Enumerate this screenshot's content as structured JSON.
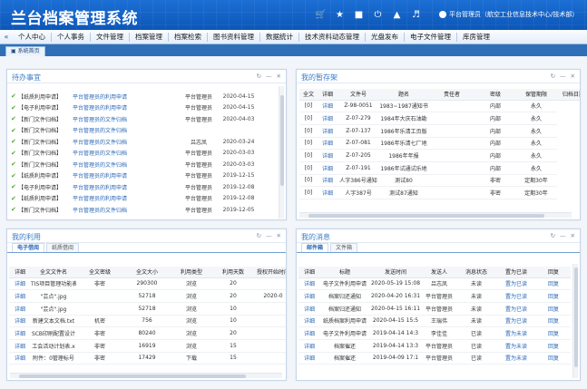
{
  "app": {
    "title": "兰台档案管理系统",
    "user": "平台管理员（航空工业信息技术中心/技术部）"
  },
  "header_icons": [
    "cart-icon",
    "star-icon",
    "lock-icon",
    "power-icon",
    "shirt-icon",
    "volume-icon"
  ],
  "nav": {
    "items": [
      "个人中心",
      "个人事务",
      "文件管理",
      "档案管理",
      "档案检索",
      "图书资料管理",
      "数据统计",
      "技术资料动态管理",
      "光盘发布",
      "电子文件管理",
      "库房管理"
    ]
  },
  "tabs": {
    "home": "系统首页"
  },
  "todo": {
    "title": "待办事宜",
    "rows": [
      {
        "tag": "【纸质利用申请】",
        "title": "平台管理员的利用申请",
        "who": "平台管理员",
        "date": "2020-04-15"
      },
      {
        "tag": "【电子利用申请】",
        "title": "平台管理员的利用申请",
        "who": "平台管理员",
        "date": "2020-04-15"
      },
      {
        "tag": "【新门文件归档】",
        "title": "平台管理员的文件归档",
        "who": "平台管理员",
        "date": "2020-04-03"
      },
      {
        "tag": "【新门文件归档】",
        "title": "平台管理员的文件归档",
        "who": "",
        "date": ""
      },
      {
        "tag": "【新门文件归档】",
        "title": "平台管理员的文件归档",
        "who": "吕志凤",
        "date": "2020-03-24"
      },
      {
        "tag": "【新门文件归档】",
        "title": "平台管理员的文件归档",
        "who": "平台管理员",
        "date": "2020-03-03"
      },
      {
        "tag": "【新门文件归档】",
        "title": "平台管理员的文件归档",
        "who": "平台管理员",
        "date": "2020-03-03"
      },
      {
        "tag": "【纸质利用申请】",
        "title": "平台管理员的利用申请",
        "who": "平台管理员",
        "date": "2019-12-15"
      },
      {
        "tag": "【电子利用申请】",
        "title": "平台管理员的利用申请",
        "who": "平台管理员",
        "date": "2019-12-08"
      },
      {
        "tag": "【纸质利用申请】",
        "title": "平台管理员的利用申请",
        "who": "平台管理员",
        "date": "2019-12-08"
      },
      {
        "tag": "【新门文件归档】",
        "title": "平台管理员的文件归档",
        "who": "平台管理员",
        "date": "2019-12-05"
      }
    ]
  },
  "archive": {
    "title": "我的暂存架",
    "columns": [
      "全文",
      "详细",
      "文件号",
      "题名",
      "责任者",
      "密级",
      "保管期限",
      "归档日期"
    ],
    "rows": [
      {
        "full": "[0]",
        "detail": "详细",
        "no": "Z-98-0051",
        "name": "1983~1987通知书",
        "owner": "",
        "secret": "内部",
        "term": "永久"
      },
      {
        "full": "[0]",
        "detail": "详细",
        "no": "Z-07-279",
        "name": "1984年大庆石油勘",
        "owner": "",
        "secret": "内部",
        "term": "永久"
      },
      {
        "full": "[0]",
        "detail": "详细",
        "no": "Z-07-137",
        "name": "1986年乐清工页版",
        "owner": "",
        "secret": "内部",
        "term": "永久"
      },
      {
        "full": "[0]",
        "detail": "详细",
        "no": "Z-07-081",
        "name": "1986年乐清七厂地",
        "owner": "",
        "secret": "内部",
        "term": "永久"
      },
      {
        "full": "[0]",
        "detail": "详细",
        "no": "Z-07-205",
        "name": "1986年年报",
        "owner": "",
        "secret": "内部",
        "term": "永久"
      },
      {
        "full": "[0]",
        "detail": "详细",
        "no": "Z-07-191",
        "name": "1986年试通试乐地",
        "owner": "",
        "secret": "内部",
        "term": "永久"
      },
      {
        "full": "[0]",
        "detail": "详细",
        "no": "人字386号通知",
        "name": "测试80",
        "owner": "",
        "secret": "非密",
        "term": "定期30年"
      },
      {
        "full": "[0]",
        "detail": "详细",
        "no": "人字387号",
        "name": "测试87通知",
        "owner": "",
        "secret": "非密",
        "term": "定期30年"
      }
    ]
  },
  "usage": {
    "title": "我的利用",
    "tabs": [
      "电子借阅",
      "纸质借阅"
    ],
    "columns": [
      "详细",
      "全文文件名",
      "全文密级",
      "全文大小",
      "利用类型",
      "利用天数",
      "授权开始时间"
    ],
    "rows": [
      {
        "detail": "详细",
        "file": "TIS项目管理功能表",
        "sec": "非密",
        "size": "290300",
        "type": "浏览",
        "days": "20",
        "start": ""
      },
      {
        "detail": "详细",
        "file": "\"芸点\".jpg",
        "sec": "",
        "size": "52718",
        "type": "浏览",
        "days": "20",
        "start": "2020-0"
      },
      {
        "detail": "详细",
        "file": "\"芸点\".jpg",
        "sec": "",
        "size": "52718",
        "type": "浏览",
        "days": "10",
        "start": ""
      },
      {
        "detail": "详细",
        "file": "新建文本文档.txt",
        "sec": "机密",
        "size": "756",
        "type": "浏览",
        "days": "10",
        "start": ""
      },
      {
        "detail": "详细",
        "file": "SCB印刷配置设计",
        "sec": "非密",
        "size": "80240",
        "type": "浏览",
        "days": "20",
        "start": ""
      },
      {
        "detail": "详细",
        "file": "工会活动计划表.x",
        "sec": "非密",
        "size": "16919",
        "type": "浏览",
        "days": "15",
        "start": ""
      },
      {
        "detail": "详细",
        "file": "附件：0管理标号",
        "sec": "非密",
        "size": "17429",
        "type": "下载",
        "days": "15",
        "start": ""
      }
    ]
  },
  "messages": {
    "title": "我的消息",
    "tabs": [
      "邮件箱",
      "文件箱"
    ],
    "columns": [
      "详细",
      "标题",
      "发送时间",
      "发送人",
      "消息状态",
      "置为已读",
      "回复"
    ],
    "rows": [
      {
        "detail": "详细",
        "subject": "电子文件利用申请",
        "time": "2020-05-19 15:08",
        "sender": "吕志凤",
        "status": "未读",
        "mark": "置为已读",
        "reply": "回复"
      },
      {
        "detail": "详细",
        "subject": "档案归还通知",
        "time": "2020-04-20 16:31",
        "sender": "平台管理员",
        "status": "未读",
        "mark": "置为已读",
        "reply": "回复"
      },
      {
        "detail": "详细",
        "subject": "档案归还通知",
        "time": "2020-04-15 16:11",
        "sender": "平台管理员",
        "status": "未读",
        "mark": "置为已读",
        "reply": "回复"
      },
      {
        "detail": "详细",
        "subject": "纸质档案利用申请",
        "time": "2020-04-15 15:5",
        "sender": "王瑞伟",
        "status": "未读",
        "mark": "置为已读",
        "reply": "回复"
      },
      {
        "detail": "详细",
        "subject": "电子文件利用申请",
        "time": "2019-04-14 14:3",
        "sender": "李佳佳",
        "status": "已读",
        "mark": "置为未读",
        "reply": "回复"
      },
      {
        "detail": "详细",
        "subject": "档案催还",
        "time": "2019-04-14 13:3",
        "sender": "平台管理员",
        "status": "已读",
        "mark": "置为未读",
        "reply": "回复"
      },
      {
        "detail": "详细",
        "subject": "档案催还",
        "time": "2019-04-09 17:1",
        "sender": "平台管理员",
        "status": "已读",
        "mark": "置为未读",
        "reply": "回复"
      }
    ]
  },
  "panel_controls": [
    "refresh-icon",
    "minimize-icon",
    "close-icon"
  ]
}
